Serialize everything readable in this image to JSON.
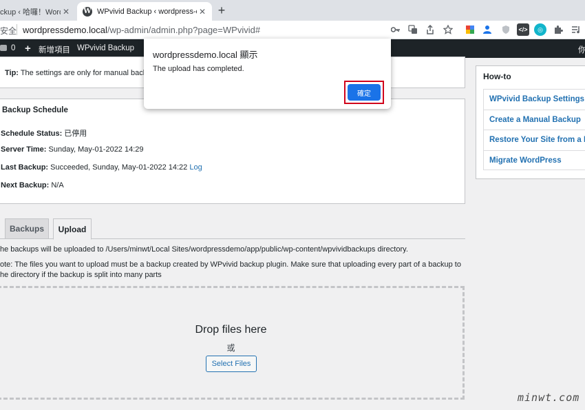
{
  "browser": {
    "tabs": [
      {
        "title": "ckup ‹ 哈囉！WordP"
      },
      {
        "title": "WPvivid Backup ‹ wordpress-d"
      }
    ],
    "new_tab": "+",
    "security_label": "安全",
    "url_host": "wordpressdemo.local",
    "url_path": "/wp-admin/admin.php?page=WPvivid#",
    "toolbar_icons": [
      "key-icon",
      "translate-icon",
      "share-icon",
      "star-icon",
      "google-ext-icon",
      "person-ext-icon",
      "shield-ext-icon",
      "code-ext-icon",
      "camera-ext-icon",
      "puzzle-icon",
      "media-icon"
    ]
  },
  "admin_bar": {
    "comment_count": "0",
    "new_item": "新增項目",
    "plugin": "WPvivid Backup",
    "right_text": "你"
  },
  "tip": {
    "label": "Tip:",
    "text": " The settings are only for manual back"
  },
  "schedule": {
    "title": "Backup Schedule",
    "status_label": "Schedule Status:",
    "status_value": " 已停用",
    "server_time_label": "Server Time:",
    "server_time_value": " Sunday, May-01-2022 14:29",
    "last_backup_label": "Last Backup:",
    "last_backup_value": " Succeeded, Sunday, May-01-2022 14:22 ",
    "log_link": "Log",
    "next_backup_label": "Next Backup:",
    "next_backup_value": " N/A"
  },
  "tabs": {
    "backups": "Backups",
    "upload": "Upload"
  },
  "upload": {
    "dir_text": "he backups will be uploaded to /Users/minwt/Local Sites/wordpressdemo/app/public/wp-content/wpvividbackups directory.",
    "note_line1": "ote: The files you want to upload must be a backup created by WPvivid backup plugin. Make sure that uploading every part of a backup to",
    "note_line2": "he directory if the backup is split into many parts",
    "drop_title": "Drop files here",
    "or": "或",
    "select_button": "Select Files"
  },
  "howto": {
    "title": "How-to",
    "items": [
      "WPvivid Backup Settings",
      "Create a Manual Backup",
      "Restore Your Site from a B",
      "Migrate WordPress"
    ]
  },
  "dialog": {
    "title": "wordpressdemo.local 顯示",
    "message": "The upload has completed.",
    "ok_button": "確定",
    "highlight_color": "#d0021b",
    "button_color": "#1a73e8"
  },
  "watermark": "minwt.com"
}
